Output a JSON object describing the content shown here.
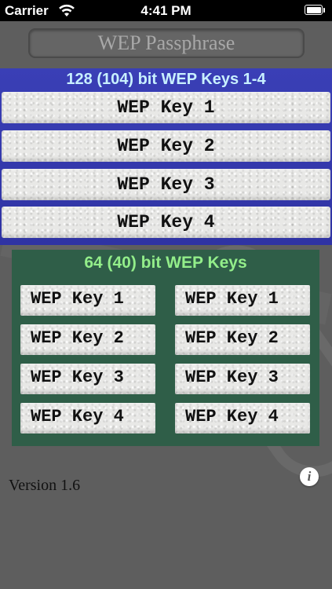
{
  "status_bar": {
    "carrier": "Carrier",
    "time": "4:41 PM",
    "wifi_icon": "wifi-icon",
    "battery_icon": "battery-icon",
    "battery_level": 1.0
  },
  "passphrase": {
    "placeholder": "WEP Passphrase"
  },
  "panel_128": {
    "title": "128 (104) bit WEP Keys 1-4",
    "background_color": "#3a3fb6",
    "title_color": "#c8f0ff",
    "keys": [
      "WEP Key 1",
      "WEP Key 2",
      "WEP Key 3",
      "WEP Key 4"
    ]
  },
  "panel_64": {
    "title": "64 (40) bit WEP Keys",
    "background_color": "#2f5e48",
    "title_color": "#93ee8a",
    "left_keys": [
      "WEP Key 1",
      "WEP Key 2",
      "WEP Key 3",
      "WEP Key 4"
    ],
    "right_keys": [
      "WEP Key 1",
      "WEP Key 2",
      "WEP Key 3",
      "WEP Key 4"
    ]
  },
  "footer": {
    "version": "Version 1.6",
    "info_icon": "info-icon",
    "info_label": "i"
  }
}
